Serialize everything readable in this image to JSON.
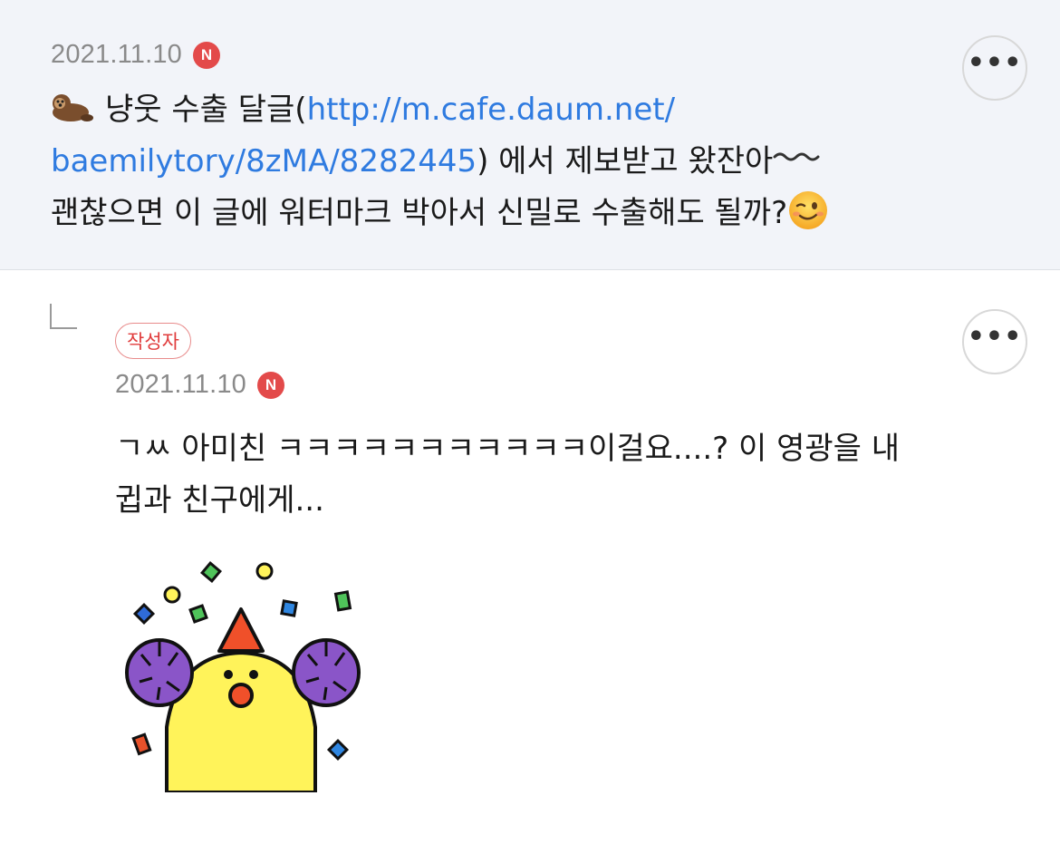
{
  "parent_comment": {
    "date": "2021.11.10",
    "badge": "N",
    "more_label": "•••",
    "emoji_lead": "otter-emoji",
    "text_part1": "냥웃 수출 달글(",
    "link_part1": "http://m.cafe.daum.net/",
    "link_part2": "baemilytory/8zMA/8282445",
    "text_part2": ") 에서 제보받고 왔잔아",
    "wave_emoji": "wavy-dash-emoji",
    "text_part3": "괜찮으면 이 글에 워터마크 박아서 신밀로 수출해도 될까?",
    "end_emoji": "winking-face-emoji"
  },
  "reply": {
    "author_badge": "작성자",
    "date": "2021.11.10",
    "badge": "N",
    "more_label": "•••",
    "text_line1": "ㄱㅆ 아미친 ㅋㅋㅋㅋㅋㅋㅋㅋㅋㅋㅋ이걸요....? 이 영광을 내",
    "text_line2": "귑과 친구에게...",
    "sticker": "celebration-sticker"
  },
  "colors": {
    "top_bg": "#f2f4f9",
    "link": "#2f7be0",
    "n_badge": "#e34a4a",
    "author_badge": "#e03c3c"
  }
}
